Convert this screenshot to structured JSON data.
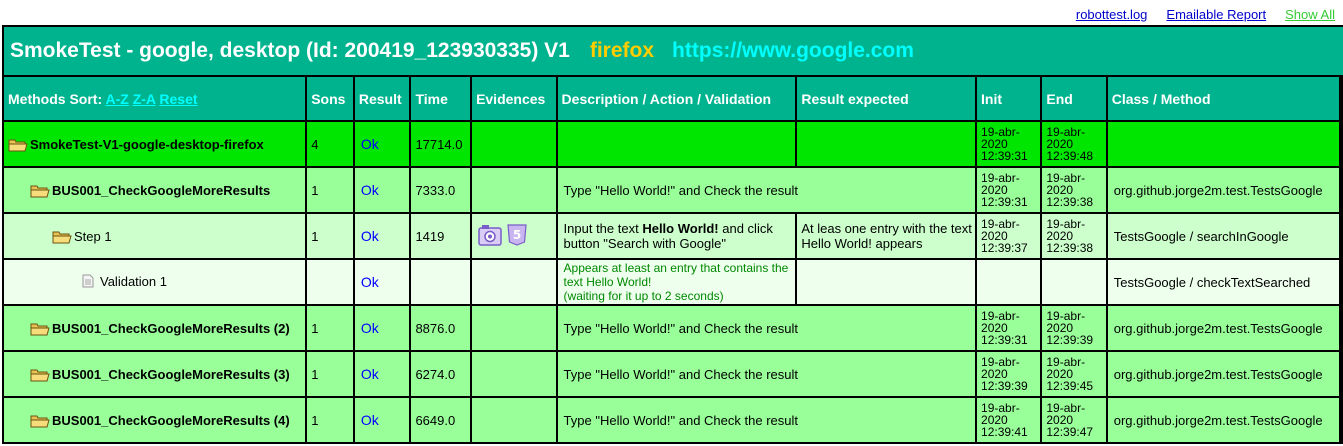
{
  "links": {
    "log": "robottest.log",
    "emailable": "Emailable Report",
    "show_all": "Show All"
  },
  "title": {
    "main": "SmokeTest - google, desktop (Id: 200419_123930335) V1",
    "browser": "firefox",
    "url": "https://www.google.com"
  },
  "headers": {
    "methods_sort": "Methods Sort:",
    "az": "A-Z",
    "za": "Z-A",
    "reset": "Reset",
    "sons": "Sons",
    "result": "Result",
    "time": "Time",
    "evidences": "Evidences",
    "description": "Description / Action / Validation",
    "expected": "Result expected",
    "init": "Init",
    "end": "End",
    "class": "Class / Method"
  },
  "rows": [
    {
      "name": "SmokeTest-V1-google-desktop-firefox",
      "sons": "4",
      "result": "Ok",
      "time": "17714.0",
      "description": "",
      "expected": "",
      "init": "19-abr-2020 12:39:31",
      "end": "19-abr-2020 12:39:48",
      "class": ""
    },
    {
      "name": "BUS001_CheckGoogleMoreResults",
      "sons": "1",
      "result": "Ok",
      "time": "7333.0",
      "description": "Type \"Hello World!\" and Check the result",
      "init": "19-abr-2020 12:39:31",
      "end": "19-abr-2020 12:39:38",
      "class": "org.github.jorge2m.test.TestsGoogle"
    },
    {
      "name": "Step 1",
      "sons": "1",
      "result": "Ok",
      "time": "1419",
      "description_pre": "Input the text ",
      "description_bold": "Hello World!",
      "description_post": " and click button \"Search with Google\"",
      "expected": "At leas one entry with the text Hello World! appears",
      "init": "19-abr-2020 12:39:37",
      "end": "19-abr-2020 12:39:38",
      "class": "TestsGoogle / searchInGoogle"
    },
    {
      "name": "Validation 1",
      "sons": "",
      "result": "Ok",
      "time": "",
      "description": "Appears at least an entry that contains the text Hello World!\n(waiting for it up to 2 seconds)",
      "expected": "",
      "init": "",
      "end": "",
      "class": "TestsGoogle / checkTextSearched"
    },
    {
      "name": "BUS001_CheckGoogleMoreResults (2)",
      "sons": "1",
      "result": "Ok",
      "time": "8876.0",
      "description": "Type \"Hello World!\" and Check the result",
      "init": "19-abr-2020 12:39:31",
      "end": "19-abr-2020 12:39:39",
      "class": "org.github.jorge2m.test.TestsGoogle"
    },
    {
      "name": "BUS001_CheckGoogleMoreResults (3)",
      "sons": "1",
      "result": "Ok",
      "time": "6274.0",
      "description": "Type \"Hello World!\" and Check the result",
      "init": "19-abr-2020 12:39:39",
      "end": "19-abr-2020 12:39:45",
      "class": "org.github.jorge2m.test.TestsGoogle"
    },
    {
      "name": "BUS001_CheckGoogleMoreResults (4)",
      "sons": "1",
      "result": "Ok",
      "time": "6649.0",
      "description": "Type \"Hello World!\" and Check the result",
      "init": "19-abr-2020 12:39:41",
      "end": "19-abr-2020 12:39:47",
      "class": "org.github.jorge2m.test.TestsGoogle"
    }
  ],
  "evidence_icons": [
    "camera-icon",
    "html5-icon"
  ],
  "colors": {
    "header": "#00b38f",
    "root_row": "#00e600",
    "method_row": "#99ff99",
    "step_row": "#ccffcc",
    "validation_row": "#eeffee",
    "browser": "#ffcc00",
    "url": "#00ffff"
  }
}
